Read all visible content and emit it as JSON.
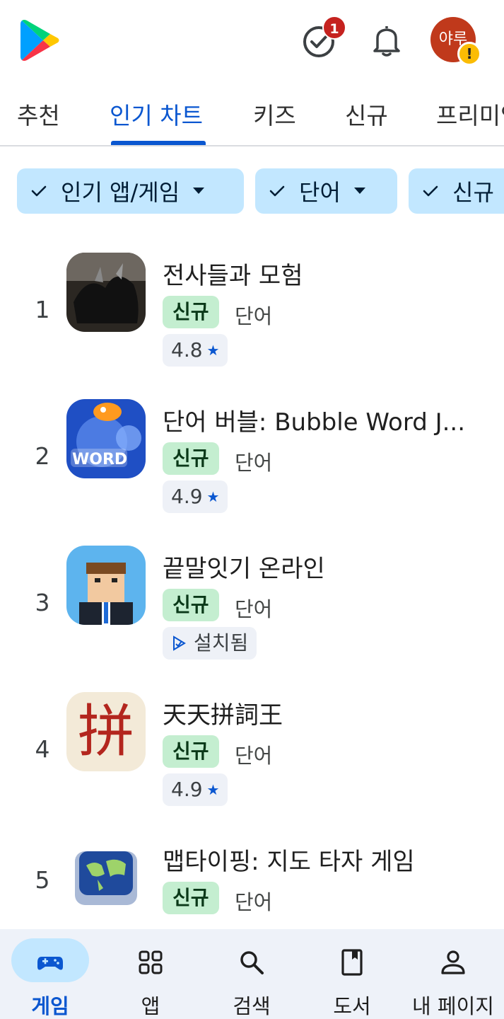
{
  "header": {
    "logo_icon": "google-play-logo",
    "notification_badge_count": "1",
    "avatar_initials": "야루",
    "avatar_color": "#c0391b",
    "warning_icon": "!"
  },
  "tabs": [
    {
      "label": "추천",
      "active": false
    },
    {
      "label": "인기 차트",
      "active": true
    },
    {
      "label": "키즈",
      "active": false
    },
    {
      "label": "신규",
      "active": false
    },
    {
      "label": "프리미엄",
      "active": false
    }
  ],
  "filters": [
    {
      "label": "인기 앱/게임",
      "checked": true,
      "dropdown": true
    },
    {
      "label": "단어",
      "checked": true,
      "dropdown": true
    },
    {
      "label": "신규",
      "checked": true,
      "dropdown": false
    }
  ],
  "apps": [
    {
      "rank": "1",
      "title": "전사들과 모험",
      "badge": "신규",
      "genre": "단어",
      "rating": "4.8",
      "installed": false
    },
    {
      "rank": "2",
      "title": "단어 버블: Bubble Word J...",
      "badge": "신규",
      "genre": "단어",
      "rating": "4.9",
      "installed": false
    },
    {
      "rank": "3",
      "title": "끝말잇기 온라인",
      "badge": "신규",
      "genre": "단어",
      "status": "설치됨",
      "installed": true
    },
    {
      "rank": "4",
      "title": "天天拼詞王",
      "badge": "신규",
      "genre": "단어",
      "rating": "4.9",
      "installed": false,
      "icon_glyph": "拼"
    },
    {
      "rank": "5",
      "title": "맵타이핑: 지도 타자 게임",
      "badge": "신규",
      "genre": "단어",
      "installed": false
    }
  ],
  "bottom_nav": [
    {
      "label": "게임",
      "icon": "gamepad-icon",
      "active": true
    },
    {
      "label": "앱",
      "icon": "apps-grid-icon",
      "active": false
    },
    {
      "label": "검색",
      "icon": "search-icon",
      "active": false
    },
    {
      "label": "도서",
      "icon": "book-icon",
      "active": false
    },
    {
      "label": "내 페이지",
      "icon": "person-icon",
      "active": false
    }
  ],
  "colors": {
    "accent": "#0b57d0",
    "chip_bg": "#c2e7ff",
    "new_badge_bg": "#c4eed0",
    "nav_bg": "#eef2f9"
  }
}
